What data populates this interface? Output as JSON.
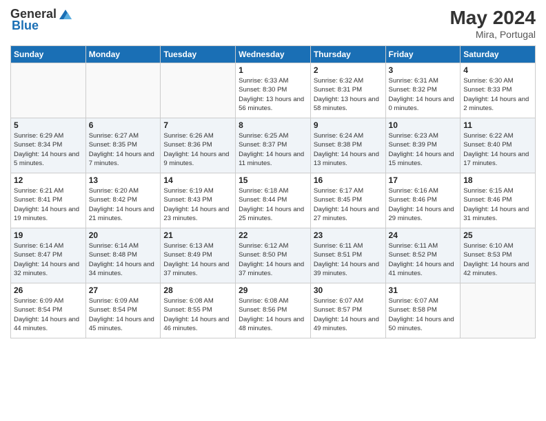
{
  "header": {
    "logo_general": "General",
    "logo_blue": "Blue",
    "month_year": "May 2024",
    "location": "Mira, Portugal"
  },
  "weekdays": [
    "Sunday",
    "Monday",
    "Tuesday",
    "Wednesday",
    "Thursday",
    "Friday",
    "Saturday"
  ],
  "weeks": [
    [
      {
        "day": "",
        "sunrise": "",
        "sunset": "",
        "daylight": ""
      },
      {
        "day": "",
        "sunrise": "",
        "sunset": "",
        "daylight": ""
      },
      {
        "day": "",
        "sunrise": "",
        "sunset": "",
        "daylight": ""
      },
      {
        "day": "1",
        "sunrise": "Sunrise: 6:33 AM",
        "sunset": "Sunset: 8:30 PM",
        "daylight": "Daylight: 13 hours and 56 minutes."
      },
      {
        "day": "2",
        "sunrise": "Sunrise: 6:32 AM",
        "sunset": "Sunset: 8:31 PM",
        "daylight": "Daylight: 13 hours and 58 minutes."
      },
      {
        "day": "3",
        "sunrise": "Sunrise: 6:31 AM",
        "sunset": "Sunset: 8:32 PM",
        "daylight": "Daylight: 14 hours and 0 minutes."
      },
      {
        "day": "4",
        "sunrise": "Sunrise: 6:30 AM",
        "sunset": "Sunset: 8:33 PM",
        "daylight": "Daylight: 14 hours and 2 minutes."
      }
    ],
    [
      {
        "day": "5",
        "sunrise": "Sunrise: 6:29 AM",
        "sunset": "Sunset: 8:34 PM",
        "daylight": "Daylight: 14 hours and 5 minutes."
      },
      {
        "day": "6",
        "sunrise": "Sunrise: 6:27 AM",
        "sunset": "Sunset: 8:35 PM",
        "daylight": "Daylight: 14 hours and 7 minutes."
      },
      {
        "day": "7",
        "sunrise": "Sunrise: 6:26 AM",
        "sunset": "Sunset: 8:36 PM",
        "daylight": "Daylight: 14 hours and 9 minutes."
      },
      {
        "day": "8",
        "sunrise": "Sunrise: 6:25 AM",
        "sunset": "Sunset: 8:37 PM",
        "daylight": "Daylight: 14 hours and 11 minutes."
      },
      {
        "day": "9",
        "sunrise": "Sunrise: 6:24 AM",
        "sunset": "Sunset: 8:38 PM",
        "daylight": "Daylight: 14 hours and 13 minutes."
      },
      {
        "day": "10",
        "sunrise": "Sunrise: 6:23 AM",
        "sunset": "Sunset: 8:39 PM",
        "daylight": "Daylight: 14 hours and 15 minutes."
      },
      {
        "day": "11",
        "sunrise": "Sunrise: 6:22 AM",
        "sunset": "Sunset: 8:40 PM",
        "daylight": "Daylight: 14 hours and 17 minutes."
      }
    ],
    [
      {
        "day": "12",
        "sunrise": "Sunrise: 6:21 AM",
        "sunset": "Sunset: 8:41 PM",
        "daylight": "Daylight: 14 hours and 19 minutes."
      },
      {
        "day": "13",
        "sunrise": "Sunrise: 6:20 AM",
        "sunset": "Sunset: 8:42 PM",
        "daylight": "Daylight: 14 hours and 21 minutes."
      },
      {
        "day": "14",
        "sunrise": "Sunrise: 6:19 AM",
        "sunset": "Sunset: 8:43 PM",
        "daylight": "Daylight: 14 hours and 23 minutes."
      },
      {
        "day": "15",
        "sunrise": "Sunrise: 6:18 AM",
        "sunset": "Sunset: 8:44 PM",
        "daylight": "Daylight: 14 hours and 25 minutes."
      },
      {
        "day": "16",
        "sunrise": "Sunrise: 6:17 AM",
        "sunset": "Sunset: 8:45 PM",
        "daylight": "Daylight: 14 hours and 27 minutes."
      },
      {
        "day": "17",
        "sunrise": "Sunrise: 6:16 AM",
        "sunset": "Sunset: 8:46 PM",
        "daylight": "Daylight: 14 hours and 29 minutes."
      },
      {
        "day": "18",
        "sunrise": "Sunrise: 6:15 AM",
        "sunset": "Sunset: 8:46 PM",
        "daylight": "Daylight: 14 hours and 31 minutes."
      }
    ],
    [
      {
        "day": "19",
        "sunrise": "Sunrise: 6:14 AM",
        "sunset": "Sunset: 8:47 PM",
        "daylight": "Daylight: 14 hours and 32 minutes."
      },
      {
        "day": "20",
        "sunrise": "Sunrise: 6:14 AM",
        "sunset": "Sunset: 8:48 PM",
        "daylight": "Daylight: 14 hours and 34 minutes."
      },
      {
        "day": "21",
        "sunrise": "Sunrise: 6:13 AM",
        "sunset": "Sunset: 8:49 PM",
        "daylight": "Daylight: 14 hours and 37 minutes."
      },
      {
        "day": "22",
        "sunrise": "Sunrise: 6:12 AM",
        "sunset": "Sunset: 8:50 PM",
        "daylight": "Daylight: 14 hours and 37 minutes."
      },
      {
        "day": "23",
        "sunrise": "Sunrise: 6:11 AM",
        "sunset": "Sunset: 8:51 PM",
        "daylight": "Daylight: 14 hours and 39 minutes."
      },
      {
        "day": "24",
        "sunrise": "Sunrise: 6:11 AM",
        "sunset": "Sunset: 8:52 PM",
        "daylight": "Daylight: 14 hours and 41 minutes."
      },
      {
        "day": "25",
        "sunrise": "Sunrise: 6:10 AM",
        "sunset": "Sunset: 8:53 PM",
        "daylight": "Daylight: 14 hours and 42 minutes."
      }
    ],
    [
      {
        "day": "26",
        "sunrise": "Sunrise: 6:09 AM",
        "sunset": "Sunset: 8:54 PM",
        "daylight": "Daylight: 14 hours and 44 minutes."
      },
      {
        "day": "27",
        "sunrise": "Sunrise: 6:09 AM",
        "sunset": "Sunset: 8:54 PM",
        "daylight": "Daylight: 14 hours and 45 minutes."
      },
      {
        "day": "28",
        "sunrise": "Sunrise: 6:08 AM",
        "sunset": "Sunset: 8:55 PM",
        "daylight": "Daylight: 14 hours and 46 minutes."
      },
      {
        "day": "29",
        "sunrise": "Sunrise: 6:08 AM",
        "sunset": "Sunset: 8:56 PM",
        "daylight": "Daylight: 14 hours and 48 minutes."
      },
      {
        "day": "30",
        "sunrise": "Sunrise: 6:07 AM",
        "sunset": "Sunset: 8:57 PM",
        "daylight": "Daylight: 14 hours and 49 minutes."
      },
      {
        "day": "31",
        "sunrise": "Sunrise: 6:07 AM",
        "sunset": "Sunset: 8:58 PM",
        "daylight": "Daylight: 14 hours and 50 minutes."
      },
      {
        "day": "",
        "sunrise": "",
        "sunset": "",
        "daylight": ""
      }
    ]
  ]
}
